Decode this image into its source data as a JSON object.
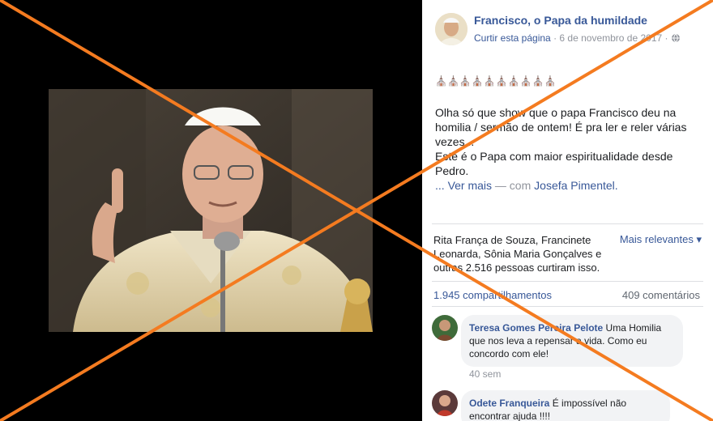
{
  "post": {
    "page_name": "Francisco, o Papa da humildade",
    "like_page": "Curtir esta página",
    "separator": "·",
    "date": "6 de novembro de 2017",
    "separator2": "·",
    "emoji_row": "⛪⛪⛪⛪⛪⛪⛪⛪⛪⛪",
    "text_line1": "Olha só que show que o papa Francisco deu na homilia / sermão de ontem! É pra ler e reler várias vezes...",
    "text_line2": "Este é o Papa com maior espiritualidade desde Pedro.",
    "ellipsis": "... ",
    "see_more": "Ver mais",
    "with_label": " — com ",
    "tagged": "Josefa Pimentel",
    "period": "."
  },
  "reactions": {
    "text": "Rita França de Souza, Francinete Leonarda, Sônia Maria Gonçalves e outras 2.516 pessoas curtiram isso.",
    "sort_label": "Mais relevantes ▾"
  },
  "stats": {
    "shares": "1.945 compartilhamentos",
    "comments": "409 comentários"
  },
  "comments": [
    {
      "author": "Teresa Gomes Pereira Pelote",
      "text": " Uma Homilia que nos leva a repensar a vida. Como eu concordo com ele!",
      "time": "40 sem"
    },
    {
      "author": "Odete Franqueira",
      "text": " É impossível não encontrar ajuda !!!!"
    }
  ],
  "colors": {
    "link": "#385898",
    "cross": "#f47b20",
    "bubble": "#f2f3f5"
  },
  "icons": [
    "globe-icon",
    "church-emoji",
    "dropdown-caret-icon"
  ]
}
